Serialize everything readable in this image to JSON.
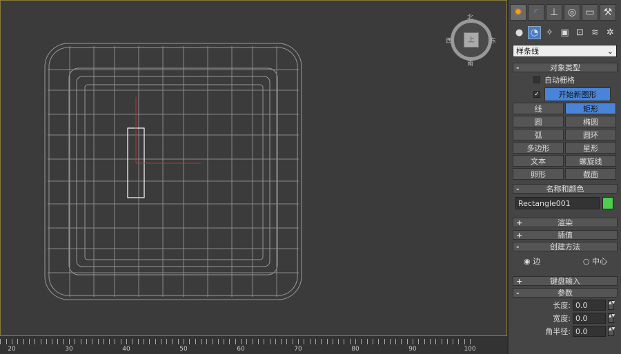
{
  "viewport": {
    "viewcube": {
      "north": "北",
      "west": "西",
      "east": "东",
      "south": "南",
      "face": "上"
    }
  },
  "ruler": {
    "labels": [
      "20",
      "30",
      "40",
      "50",
      "60",
      "70",
      "80",
      "90",
      "100"
    ]
  },
  "panel": {
    "tabs": [
      {
        "icon": "create-icon"
      },
      {
        "icon": "modify-icon"
      },
      {
        "icon": "hierarchy-icon"
      },
      {
        "icon": "motion-icon"
      },
      {
        "icon": "display-icon"
      },
      {
        "icon": "utilities-icon"
      }
    ],
    "subtabs": [
      {
        "icon": "geometry-icon"
      },
      {
        "icon": "shapes-icon"
      },
      {
        "icon": "lights-icon"
      },
      {
        "icon": "cameras-icon"
      },
      {
        "icon": "helpers-icon"
      },
      {
        "icon": "spacewarps-icon"
      },
      {
        "icon": "systems-icon"
      }
    ],
    "category": "样条线",
    "object_type": {
      "title": "对象类型",
      "autogrid": "自动栅格",
      "start_new_shape": "开始新图形",
      "start_new_shape_checked": true,
      "buttons": [
        "线",
        "矩形",
        "圆",
        "椭圆",
        "弧",
        "圆环",
        "多边形",
        "星形",
        "文本",
        "螺旋线",
        "卵形",
        "截面"
      ],
      "active": "矩形"
    },
    "name_color": {
      "title": "名称和颜色",
      "name": "Rectangle001",
      "color": "#4ccf4c"
    },
    "rendering": {
      "title": "渲染"
    },
    "interpolation": {
      "title": "插值"
    },
    "creation_method": {
      "title": "创建方法",
      "edge": "边",
      "center": "中心",
      "selected": "边"
    },
    "keyboard_entry": {
      "title": "键盘输入"
    },
    "parameters": {
      "title": "参数",
      "length_label": "长度:",
      "length": "0.0",
      "width_label": "宽度:",
      "width": "0.0",
      "corner_label": "角半径:",
      "corner": "0.0"
    }
  }
}
